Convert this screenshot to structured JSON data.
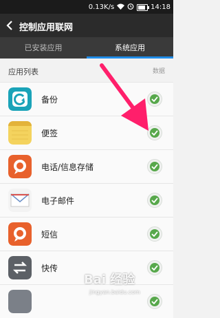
{
  "status_bar": {
    "speed": "0.13K/s",
    "time": "14:18"
  },
  "title_bar": {
    "title": "控制应用联网"
  },
  "tabs": [
    {
      "label": "已安装应用",
      "active": false
    },
    {
      "label": "系统应用",
      "active": true
    }
  ],
  "section": {
    "title": "应用列表",
    "column": "数据"
  },
  "apps": [
    {
      "name": "备份",
      "icon": "backup-icon",
      "checked": true
    },
    {
      "name": "便签",
      "icon": "notes-icon",
      "checked": true
    },
    {
      "name": "电话/信息存储",
      "icon": "phone-storage-icon",
      "checked": true
    },
    {
      "name": "电子邮件",
      "icon": "email-icon",
      "checked": true
    },
    {
      "name": "短信",
      "icon": "sms-icon",
      "checked": true
    },
    {
      "name": "快传",
      "icon": "quick-transfer-icon",
      "checked": true
    },
    {
      "name": "",
      "icon": "unknown-app-icon",
      "checked": true
    }
  ],
  "watermark": {
    "main": "Bai 经验",
    "sub": "jingyan.baidu.com"
  },
  "colors": {
    "accent": "#1f8ce8",
    "check": "#57a84b",
    "arrow": "#ff1f6b"
  }
}
